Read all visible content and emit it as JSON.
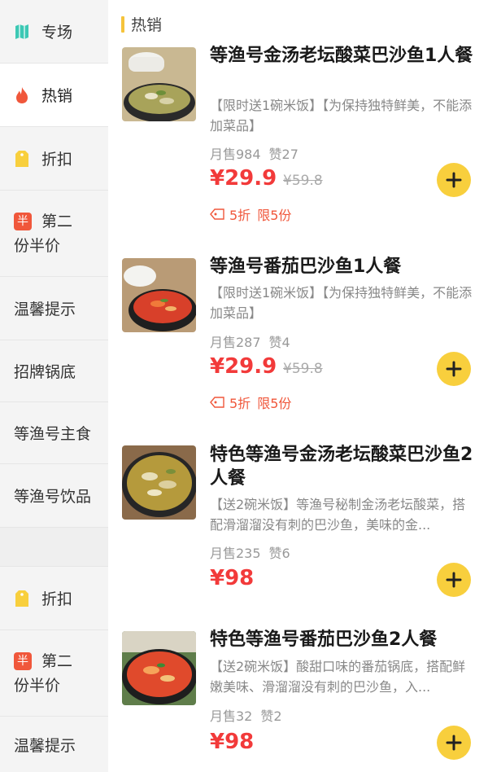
{
  "sidebar": {
    "items": [
      {
        "label": "专场",
        "icon": "flag-icon"
      },
      {
        "label": "热销",
        "icon": "flame-icon"
      },
      {
        "label": "折扣",
        "icon": "price-tag-icon"
      },
      {
        "label_line1": "第二",
        "label_line2": "份半价",
        "badge": "半"
      },
      {
        "label": "温馨提示"
      },
      {
        "label": "招牌锅底"
      },
      {
        "label": "等渔号主食"
      },
      {
        "label": "等渔号饮品"
      },
      {
        "label": "折扣",
        "icon": "price-tag-icon"
      },
      {
        "label_line1": "第二",
        "label_line2": "份半价",
        "badge": "半"
      },
      {
        "label": "温馨提示"
      }
    ]
  },
  "section": {
    "title": "热销"
  },
  "products": [
    {
      "name": "等渔号金汤老坛酸菜巴沙鱼1人餐",
      "desc": "【限时送1碗米饭】【为保持独特鲜美，不能添加菜品】",
      "monthly_sales": "月售984",
      "likes": "赞27",
      "price": "¥29.9",
      "original_price": "¥59.8",
      "discount": "5折",
      "limit": "限5份"
    },
    {
      "name": "等渔号番茄巴沙鱼1人餐",
      "desc": "【限时送1碗米饭】【为保持独特鲜美，不能添加菜品】",
      "monthly_sales": "月售287",
      "likes": "赞4",
      "price": "¥29.9",
      "original_price": "¥59.8",
      "discount": "5折",
      "limit": "限5份"
    },
    {
      "name": "特色等渔号金汤老坛酸菜巴沙鱼2人餐",
      "desc": "【送2碗米饭】等渔号秘制金汤老坛酸菜，搭配滑溜溜没有刺的巴沙鱼，美味的金...",
      "monthly_sales": "月售235",
      "likes": "赞6",
      "price": "¥98"
    },
    {
      "name": "特色等渔号番茄巴沙鱼2人餐",
      "desc": "【送2碗米饭】酸甜口味的番茄锅底，搭配鲜嫩美味、滑溜溜没有刺的巴沙鱼，入...",
      "monthly_sales": "月售32",
      "likes": "赞2",
      "price": "¥98"
    }
  ],
  "colors": {
    "accent_yellow": "#f8cf3d",
    "price_red": "#f23a3a",
    "discount_orange": "#f0573b",
    "section_bar": "#f5c33b",
    "flag_teal": "#3cc8b4"
  }
}
